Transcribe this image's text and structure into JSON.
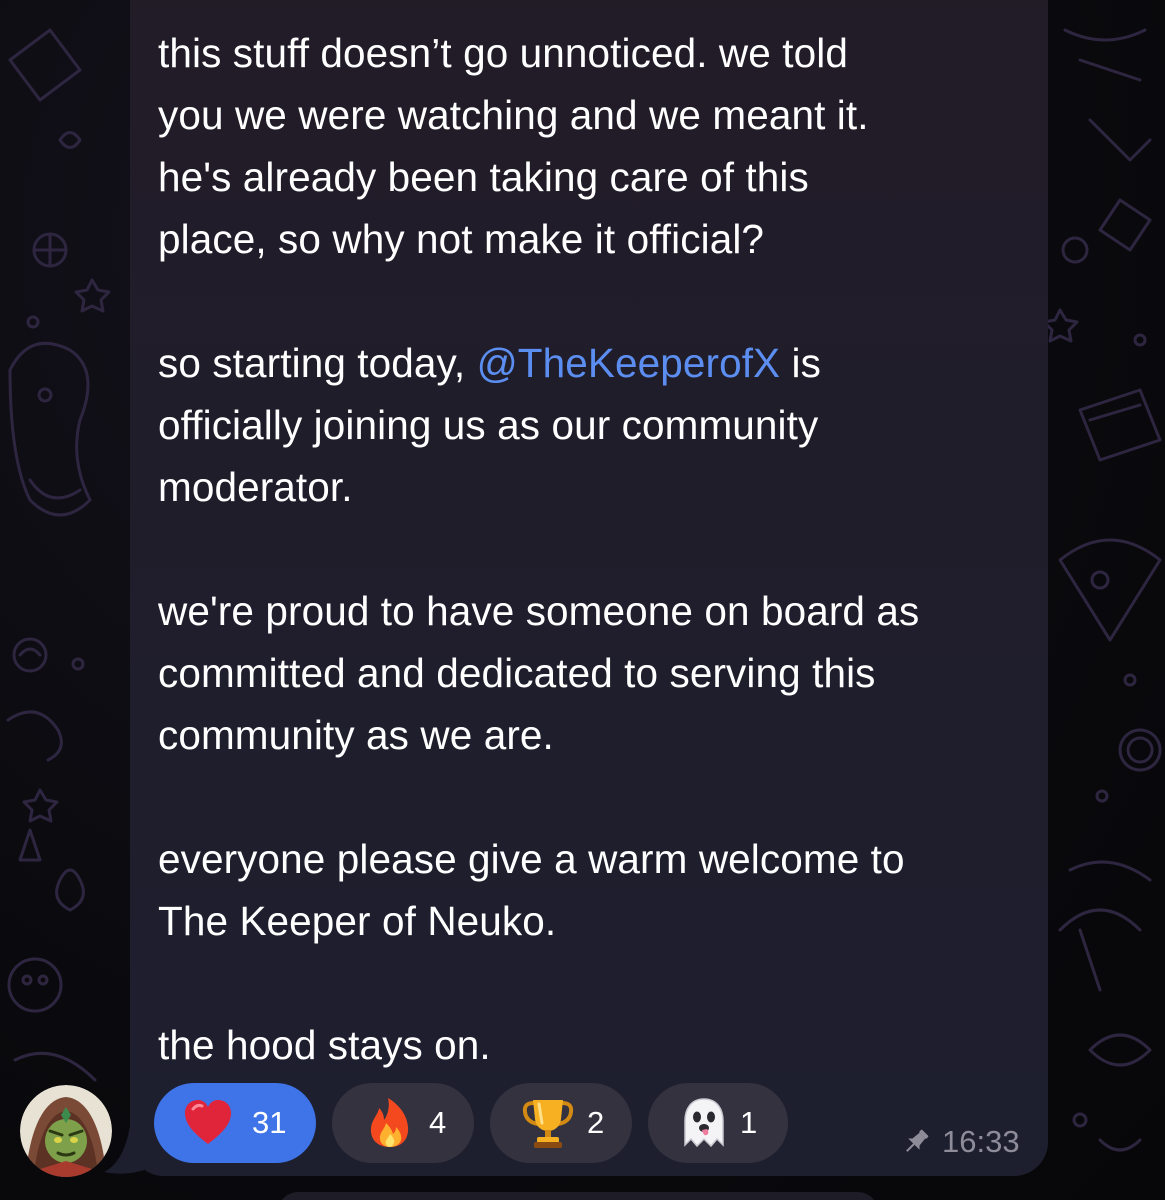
{
  "message": {
    "text_before_mention": "this stuff doesn’t go unnoticed. we told\nyou we were watching and we meant it.\nhe's already been taking care of this\nplace, so why not make it official?\n\nso starting today, ",
    "mention": "@TheKeeperofX",
    "text_after_mention": " is\nofficially joining us as our community\nmoderator.\n\nwe're proud to have someone on board as\ncommitted and dedicated to serving this\ncommunity as we are.\n\neveryone please give a warm welcome to\nThe Keeper of Neuko.\n\nthe hood stays on.",
    "time": "16:33",
    "pinned_icon": "pin-icon"
  },
  "reactions": [
    {
      "emoji": "heart",
      "count": "31",
      "active": true
    },
    {
      "emoji": "fire",
      "count": "4",
      "active": false
    },
    {
      "emoji": "trophy",
      "count": "2",
      "active": false
    },
    {
      "emoji": "ghost",
      "count": "1",
      "active": false
    }
  ],
  "colors": {
    "bubble": "#201d2b",
    "mention": "#5b8ef0",
    "active_reaction": "#3f74e8",
    "reaction": "#34323f",
    "meta_text": "#8e8c99"
  }
}
